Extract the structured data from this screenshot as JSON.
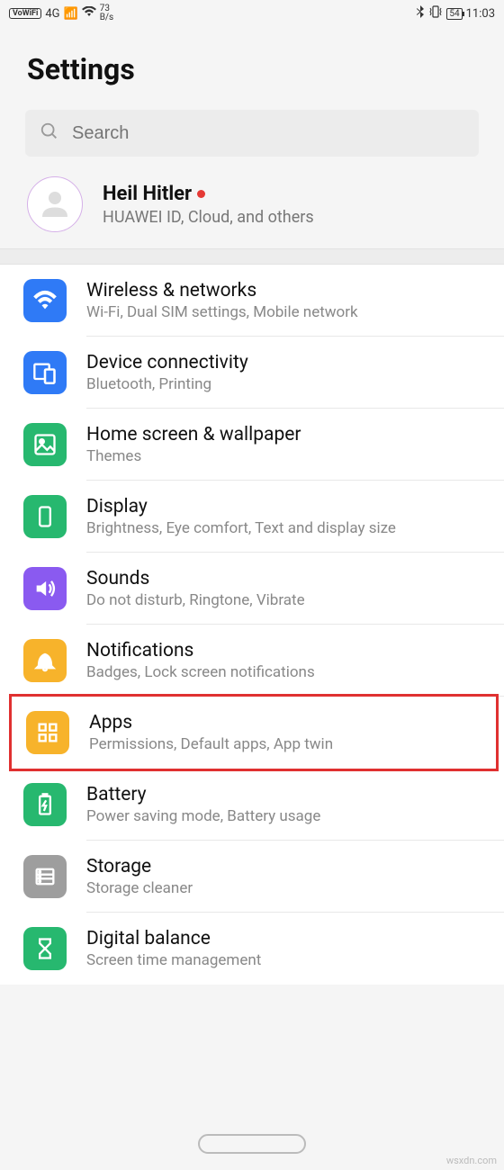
{
  "status_bar": {
    "vowifi": "VoWiFi",
    "network": "4G",
    "speed_num": "73",
    "speed_unit": "B/s",
    "battery": "54",
    "time": "11:03"
  },
  "header": {
    "title": "Settings"
  },
  "search": {
    "placeholder": "Search"
  },
  "account": {
    "name": "Heil Hitler",
    "subtitle": "HUAWEI ID, Cloud, and others"
  },
  "items": [
    {
      "title": "Wireless & networks",
      "subtitle": "Wi-Fi, Dual SIM settings, Mobile network",
      "color": "#2f7af6",
      "icon": "wifi"
    },
    {
      "title": "Device connectivity",
      "subtitle": "Bluetooth, Printing",
      "color": "#2f7af6",
      "icon": "device"
    },
    {
      "title": "Home screen & wallpaper",
      "subtitle": "Themes",
      "color": "#27b86f",
      "icon": "wallpaper"
    },
    {
      "title": "Display",
      "subtitle": "Brightness, Eye comfort, Text and display size",
      "color": "#27b86f",
      "icon": "display"
    },
    {
      "title": "Sounds",
      "subtitle": "Do not disturb, Ringtone, Vibrate",
      "color": "#8a5af0",
      "icon": "sound"
    },
    {
      "title": "Notifications",
      "subtitle": "Badges, Lock screen notifications",
      "color": "#f7b32b",
      "icon": "bell"
    },
    {
      "title": "Apps",
      "subtitle": "Permissions, Default apps, App twin",
      "color": "#f7b32b",
      "icon": "apps",
      "highlight": true
    },
    {
      "title": "Battery",
      "subtitle": "Power saving mode, Battery usage",
      "color": "#27b86f",
      "icon": "battery"
    },
    {
      "title": "Storage",
      "subtitle": "Storage cleaner",
      "color": "#9e9e9e",
      "icon": "storage"
    },
    {
      "title": "Digital balance",
      "subtitle": "Screen time management",
      "color": "#27b86f",
      "icon": "hourglass"
    }
  ],
  "watermark": "wsxdn.com"
}
